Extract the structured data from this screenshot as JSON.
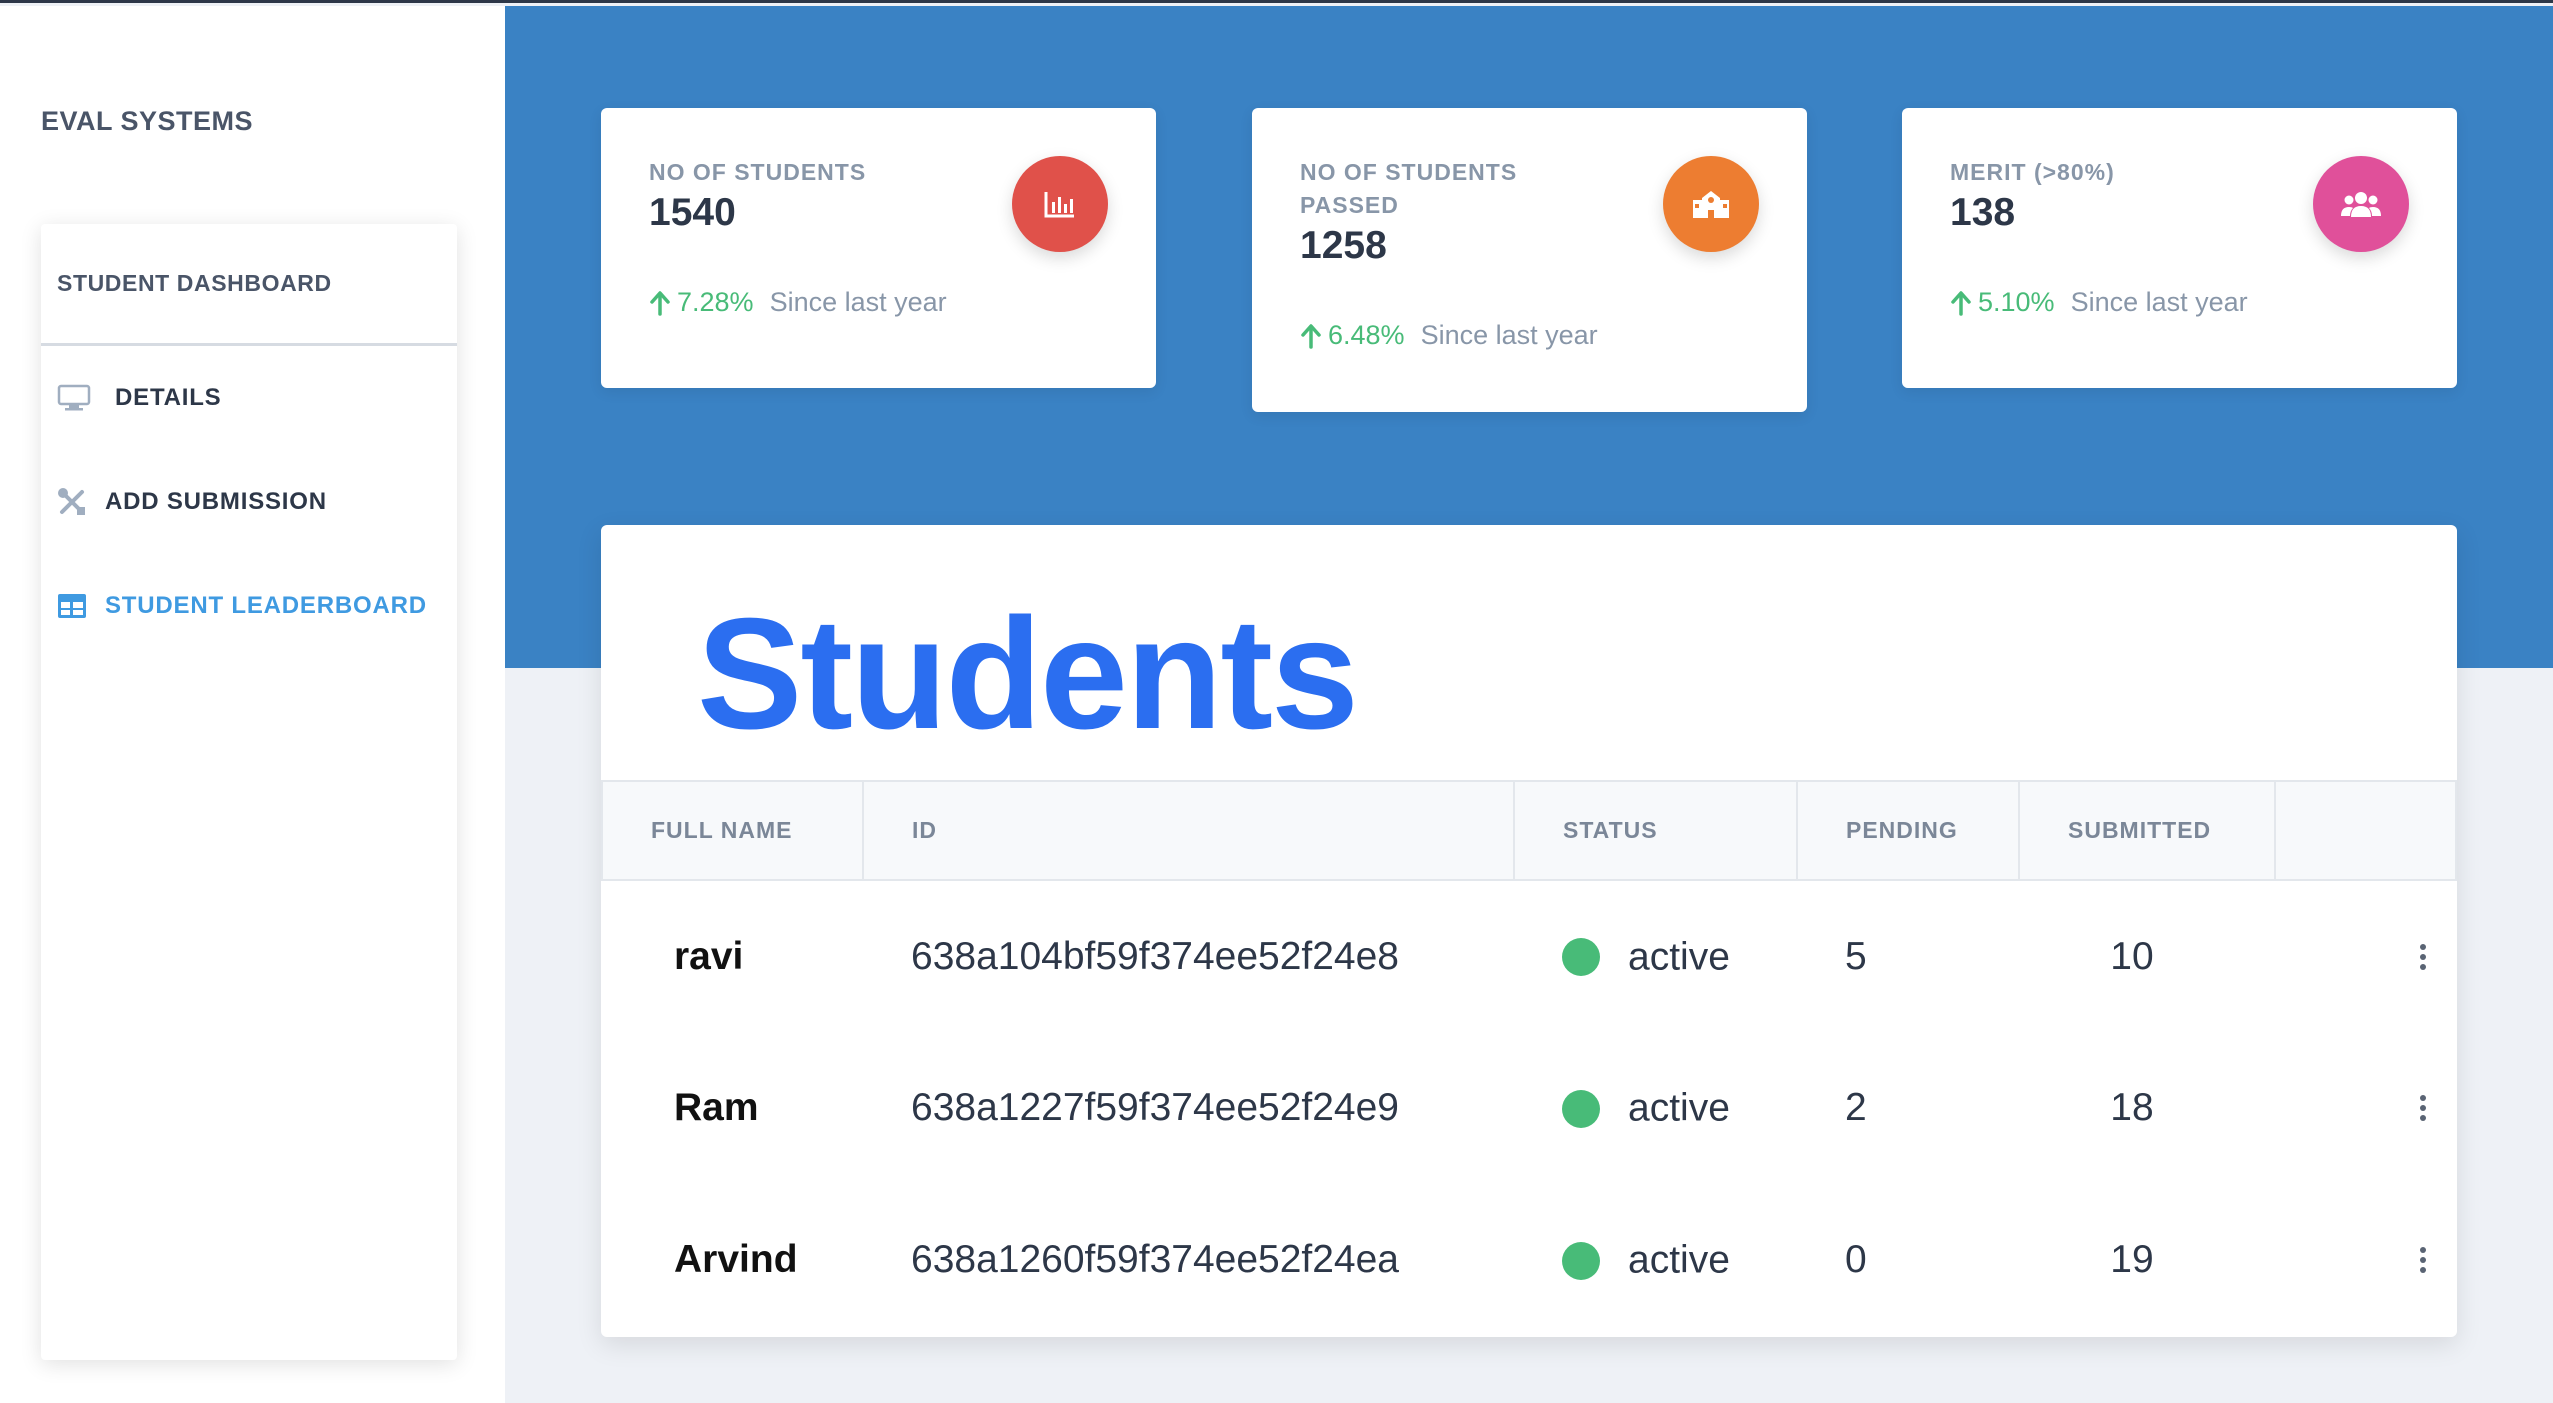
{
  "app": {
    "brand": "EVAL SYSTEMS"
  },
  "sidebar": {
    "heading": "STUDENT DASHBOARD",
    "items": [
      {
        "label": "DETAILS",
        "icon": "monitor-icon",
        "active": false
      },
      {
        "label": "ADD SUBMISSION",
        "icon": "tools-icon",
        "active": false
      },
      {
        "label": "STUDENT LEADERBOARD",
        "icon": "table-icon",
        "active": true
      }
    ]
  },
  "stats": [
    {
      "label": "NO OF STUDENTS",
      "value": "1540",
      "change": "7.28%",
      "since": "Since last year",
      "icon": "bar-chart-icon",
      "color": "#e0514a"
    },
    {
      "label": "NO OF STUDENTS PASSED",
      "value": "1258",
      "change": "6.48%",
      "since": "Since last year",
      "icon": "school-icon",
      "color": "#ed7d31"
    },
    {
      "label": "MERIT (>80%)",
      "value": "138",
      "change": "5.10%",
      "since": "Since last year",
      "icon": "users-icon",
      "color": "#e0509a"
    }
  ],
  "table": {
    "title": "Students",
    "columns": [
      "FULL NAME",
      "ID",
      "STATUS",
      "PENDING",
      "SUBMITTED",
      ""
    ],
    "rows": [
      {
        "name": "ravi",
        "id": "638a104bf59f374ee52f24e8",
        "status": "active",
        "pending": "5",
        "submitted": "10"
      },
      {
        "name": "Ram",
        "id": "638a1227f59f374ee52f24e9",
        "status": "active",
        "pending": "2",
        "submitted": "18"
      },
      {
        "name": "Arvind",
        "id": "638a1260f59f374ee52f24ea",
        "status": "active",
        "pending": "0",
        "submitted": "19"
      }
    ]
  },
  "colors": {
    "header_bg": "#3a82c4",
    "title": "#2b6ef0",
    "positive": "#48bb78",
    "active_nav": "#3f9ae1"
  }
}
